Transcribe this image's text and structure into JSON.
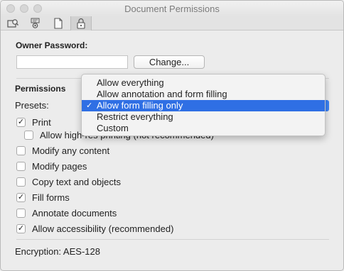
{
  "window": {
    "title": "Document Permissions"
  },
  "toolbar": {
    "buttons": [
      {
        "icon": "security-settings-icon"
      },
      {
        "icon": "certificate-icon"
      },
      {
        "icon": "document-icon"
      },
      {
        "icon": "lock-icon",
        "selected": true
      }
    ]
  },
  "owner": {
    "label": "Owner Password:",
    "password_value": "",
    "change_label": "Change..."
  },
  "permissions": {
    "heading": "Permissions",
    "presets_label": "Presets:"
  },
  "presets_menu": {
    "options": [
      "Allow everything",
      "Allow annotation and form filling",
      "Allow form filling only",
      "Restrict everything",
      "Custom"
    ],
    "selected": "Allow form filling only"
  },
  "options": [
    {
      "label": "Print",
      "checked": true
    },
    {
      "label": "Allow high-res printing (not recommended)",
      "checked": false
    },
    {
      "label": "Modify any content",
      "checked": false
    },
    {
      "label": "Modify pages",
      "checked": false
    },
    {
      "label": "Copy text and objects",
      "checked": false
    },
    {
      "label": "Fill forms",
      "checked": true
    },
    {
      "label": "Annotate documents",
      "checked": false
    },
    {
      "label": "Allow accessibility (recommended)",
      "checked": true
    }
  ],
  "encryption": {
    "label": "Encryption: AES-128"
  },
  "colors": {
    "accent": "#2f6fe4",
    "window_bg": "#ececec"
  }
}
